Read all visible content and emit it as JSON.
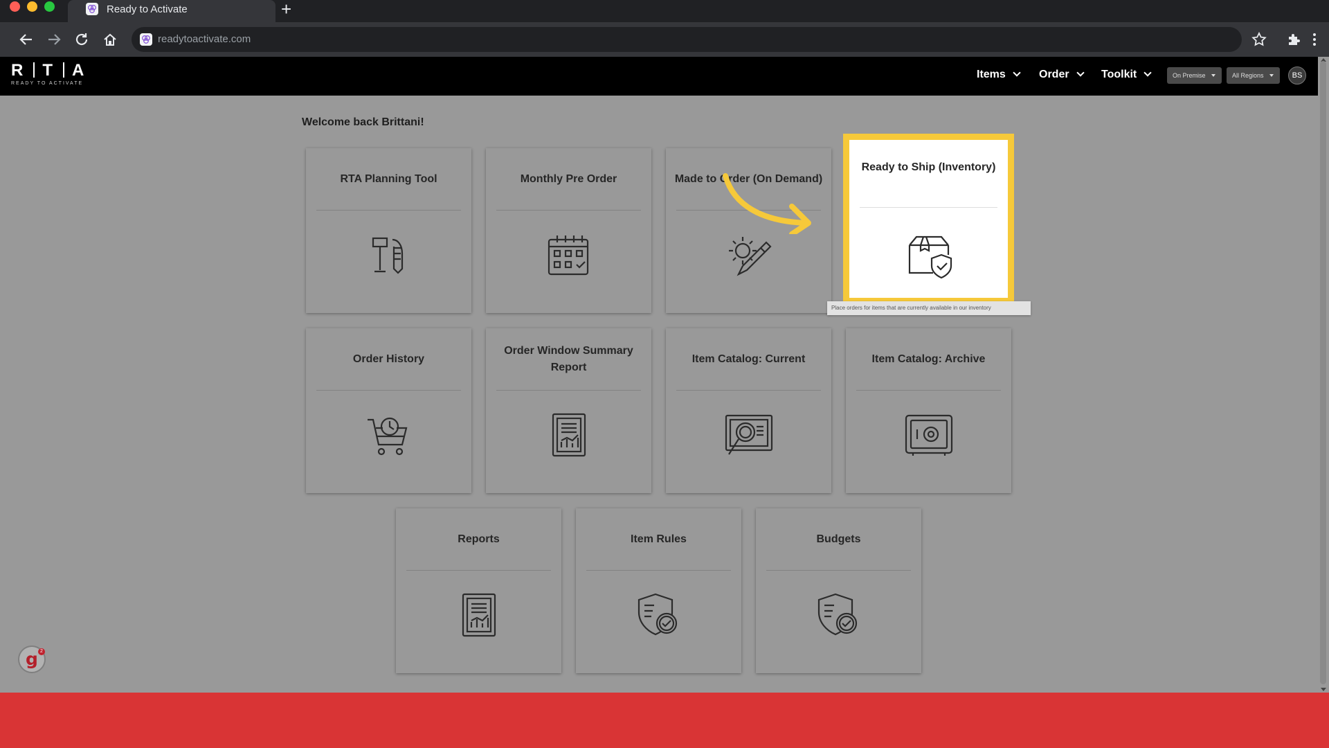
{
  "browser": {
    "tab_title": "Ready to Activate",
    "new_tab_label": "+",
    "url": "readytoactivate.com"
  },
  "header": {
    "logo_letters": [
      "R",
      "T",
      "A"
    ],
    "logo_tagline": "READY TO ACTIVATE",
    "nav": [
      {
        "label": "Items"
      },
      {
        "label": "Order"
      },
      {
        "label": "Toolkit"
      }
    ],
    "env_select": "On Premise",
    "region_select": "All Regions",
    "avatar_initials": "BS"
  },
  "welcome": "Welcome back Brittani!",
  "tiles": [
    {
      "label": "RTA Planning Tool",
      "icon": "planning-tool-icon"
    },
    {
      "label": "Monthly Pre Order",
      "icon": "calendar-icon"
    },
    {
      "label": "Made to Order (On Demand)",
      "icon": "gear-pencil-icon"
    },
    {
      "label": "Ready to Ship (Inventory)",
      "icon": "box-shield-icon"
    },
    {
      "label": "Order History",
      "icon": "cart-clock-icon"
    },
    {
      "label": "Order Window Summary Report",
      "icon": "report-icon"
    },
    {
      "label": "Item Catalog: Current",
      "icon": "magnifier-icon"
    },
    {
      "label": "Item Catalog: Archive",
      "icon": "safe-icon"
    },
    {
      "label": "Reports",
      "icon": "report-icon"
    },
    {
      "label": "Item Rules",
      "icon": "shield-check-icon"
    },
    {
      "label": "Budgets",
      "icon": "shield-check-icon"
    }
  ],
  "tooltip": "Place orders for items that are currently available in our inventory",
  "widget": {
    "letter": "g",
    "badge": "2"
  },
  "colors": {
    "highlight": "#f6c93a",
    "header": "#000000",
    "footer": "#d93435"
  }
}
